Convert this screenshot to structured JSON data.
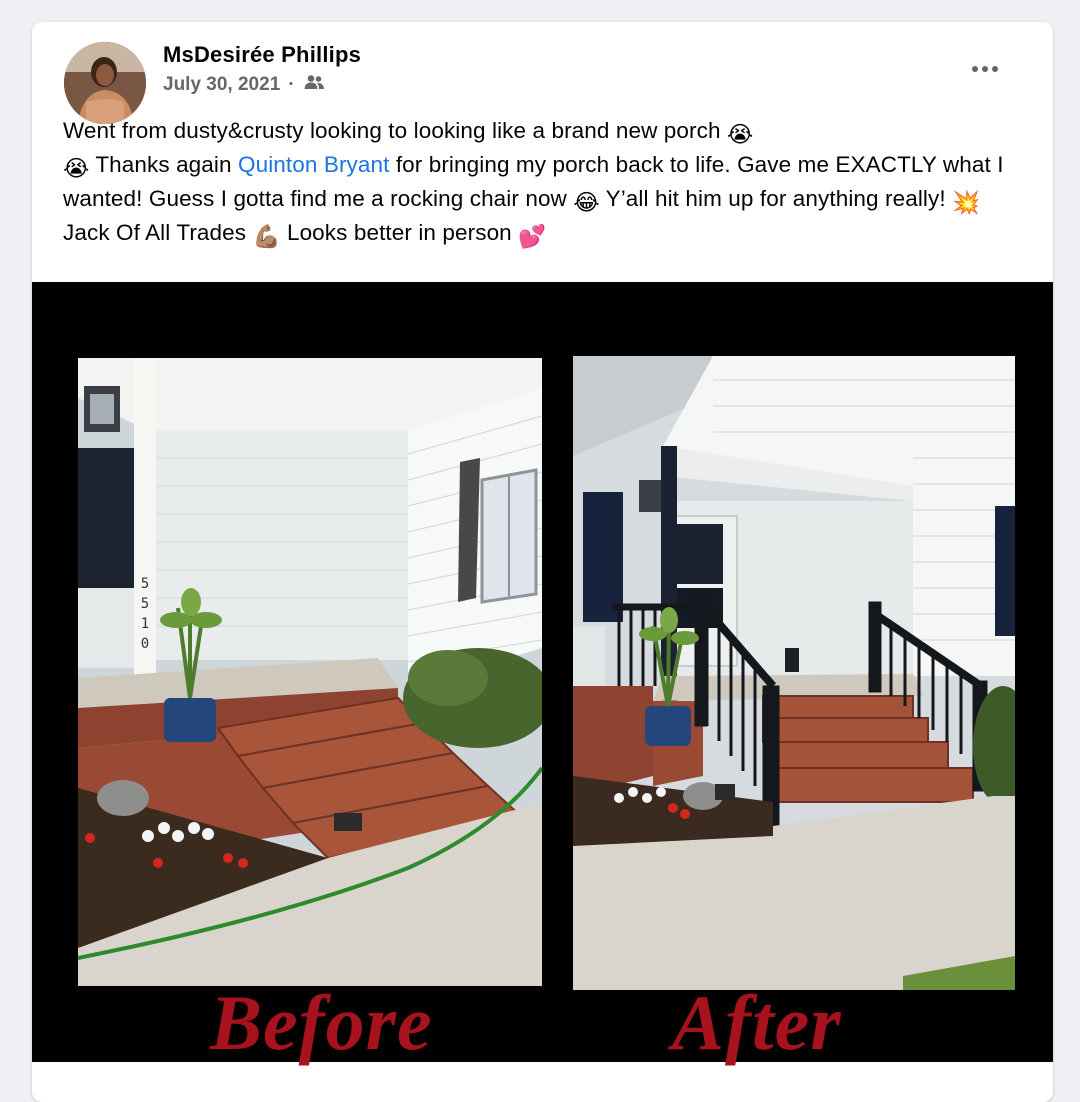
{
  "post": {
    "author": "MsDesirée Phillips",
    "date": "July 30, 2021",
    "separator": "·",
    "audience_icon": "friends-icon",
    "more_icon": "more-options-icon",
    "text": {
      "p1": "Went from dusty&crusty looking to looking like a brand new porch ",
      "p2": " Thanks again ",
      "mention": "Quinton Bryant",
      "p3": " for bringing my porch back to life. Gave me EXACTLY what I wanted! Guess I gotta find me a rocking chair now ",
      "p4": " Y’all hit him up for anything really! ",
      "p5": "Jack Of All Trades ",
      "p6": " Looks better in person "
    },
    "emojis": {
      "crying1": "😭",
      "crying2": "😭",
      "laughing": "😂",
      "boom": "💥",
      "muscle": "💪🏽",
      "hearts": "💕"
    }
  },
  "image": {
    "before_label": "Before",
    "after_label": "After",
    "colors": {
      "label": "#a8121c",
      "siding": "#eef1f4",
      "brick": "#9a4a34",
      "railing": "#15171c",
      "concrete": "#d8d4cc"
    }
  }
}
